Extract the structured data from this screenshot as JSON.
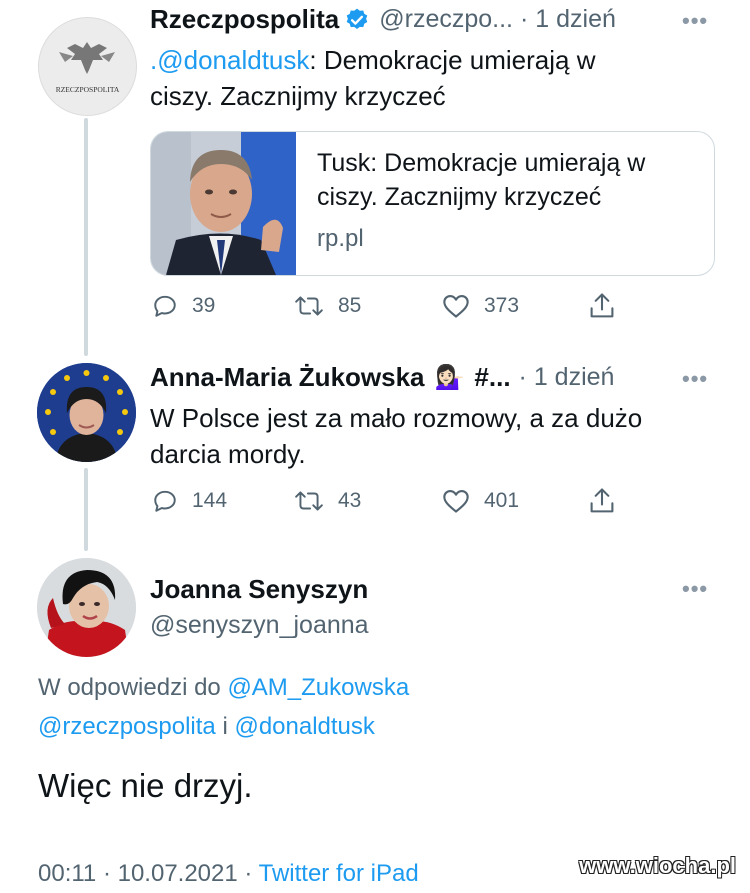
{
  "colors": {
    "accent": "#1d9bf0",
    "text": "#0f1419",
    "muted": "#536471",
    "border": "#cfd9de"
  },
  "tweet1": {
    "author": "Rzeczpospolita",
    "handle": "@rzeczpo...",
    "time": "· 1 dzień",
    "mention": ".@donaldtusk",
    "text_line1_rest": ": Demokracje umierają w",
    "text_line2": "ciszy. Zacznijmy krzyczeć",
    "avatar_logo_text": "RZECZPOSPOLITA",
    "card": {
      "title": "Tusk: Demokracje umierają w ciszy. Zacznijmy krzyczeć",
      "domain": "rp.pl"
    },
    "replies": "39",
    "retweets": "85",
    "likes": "373"
  },
  "tweet2": {
    "author": "Anna-Maria Żukowska",
    "emoji": "💁🏻‍♀️",
    "author_suffix": "#...",
    "time": "· 1 dzień",
    "text_line1": "W Polsce jest za mało rozmowy, a za dużo",
    "text_line2": "darcia mordy.",
    "replies": "144",
    "retweets": "43",
    "likes": "401"
  },
  "tweet3": {
    "author": "Joanna Senyszyn",
    "handle": "@senyszyn_joanna",
    "reply_prefix": "W odpowiedzi do ",
    "reply_mention1": "@AM_Zukowska",
    "reply_mention2": "@rzeczpospolita",
    "reply_and": " i ",
    "reply_mention3": "@donaldtusk",
    "text": "Więc nie drzyj.",
    "timestamp": "00:11 · 10.07.2021 · ",
    "source": "Twitter for iPad"
  },
  "icons": {
    "reply": "reply-icon",
    "retweet": "retweet-icon",
    "like": "like-icon",
    "share": "share-icon",
    "more": "more-icon",
    "verified": "verified-icon"
  },
  "watermark": "www.wiocha.pl"
}
